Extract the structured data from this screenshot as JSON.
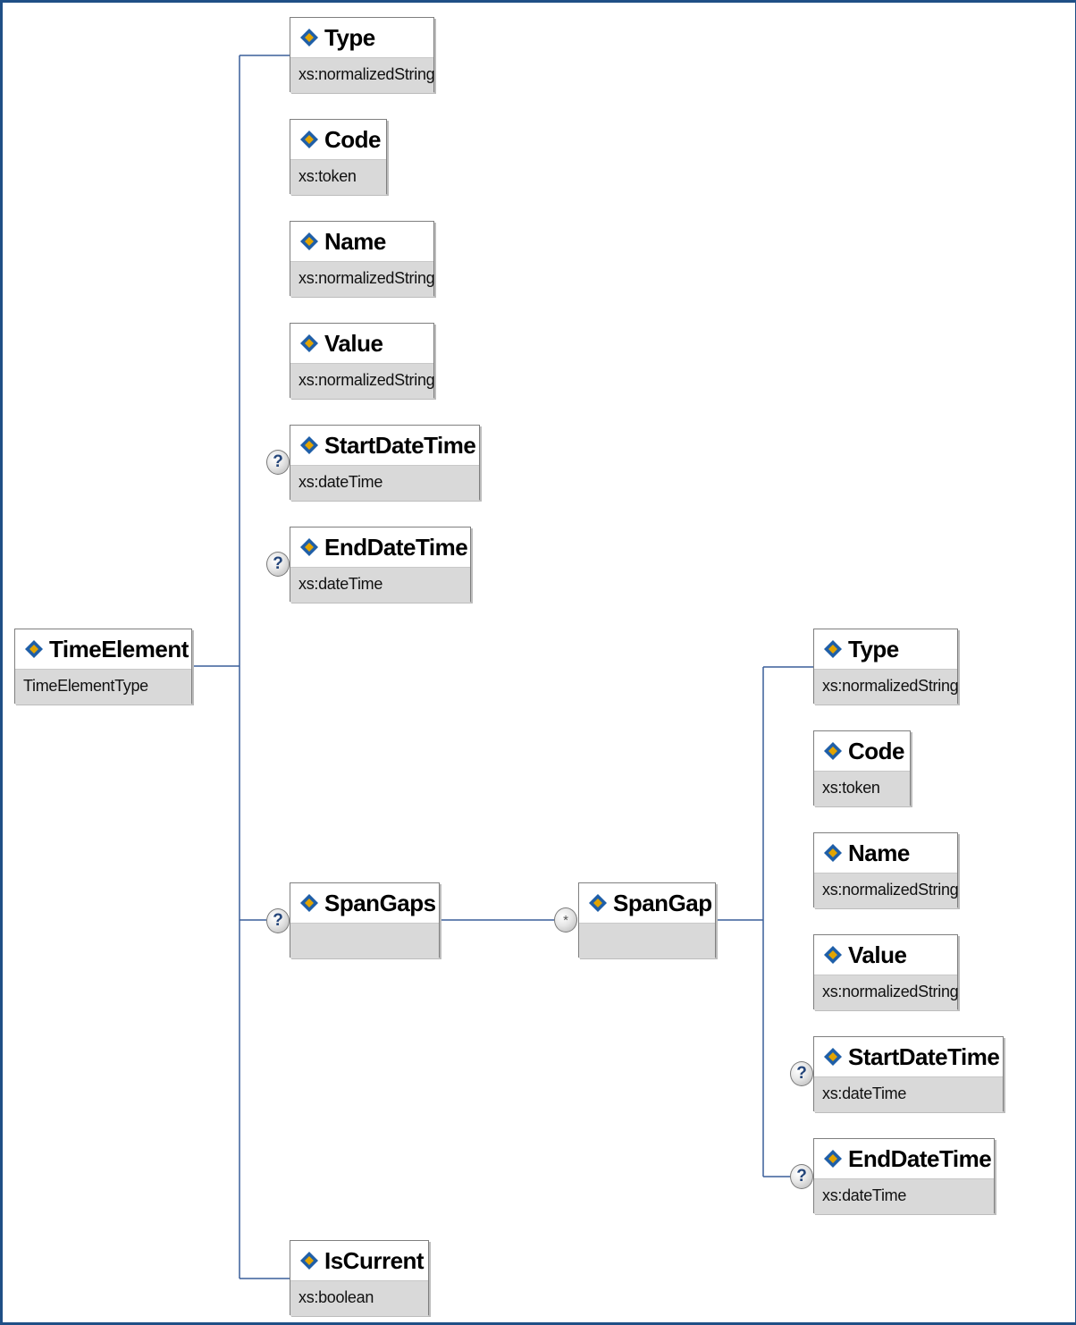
{
  "root": {
    "name": "TimeElement",
    "type": "TimeElementType"
  },
  "children": [
    {
      "name": "Type",
      "type": "xs:normalizedString",
      "optional": false
    },
    {
      "name": "Code",
      "type": "xs:token",
      "optional": false
    },
    {
      "name": "Name",
      "type": "xs:normalizedString",
      "optional": false
    },
    {
      "name": "Value",
      "type": "xs:normalizedString",
      "optional": false
    },
    {
      "name": "StartDateTime",
      "type": "xs:dateTime",
      "optional": true
    },
    {
      "name": "EndDateTime",
      "type": "xs:dateTime",
      "optional": true
    },
    {
      "name": "SpanGaps",
      "type": "",
      "optional": true
    },
    {
      "name": "IsCurrent",
      "type": "xs:boolean",
      "optional": false
    }
  ],
  "span_gap": {
    "name": "SpanGap",
    "type": "",
    "multiplicity": "*"
  },
  "span_gap_children": [
    {
      "name": "Type",
      "type": "xs:normalizedString",
      "optional": false
    },
    {
      "name": "Code",
      "type": "xs:token",
      "optional": false
    },
    {
      "name": "Name",
      "type": "xs:normalizedString",
      "optional": false
    },
    {
      "name": "Value",
      "type": "xs:normalizedString",
      "optional": false
    },
    {
      "name": "StartDateTime",
      "type": "xs:dateTime",
      "optional": true
    },
    {
      "name": "EndDateTime",
      "type": "xs:dateTime",
      "optional": true
    }
  ],
  "optional_marker": "?",
  "colors": {
    "frame": "#1f4f86",
    "connector": "#3a5f9a",
    "type_band": "#d9d9d9",
    "icon_blue": "#1f5fa8",
    "icon_gold": "#e2a400"
  }
}
